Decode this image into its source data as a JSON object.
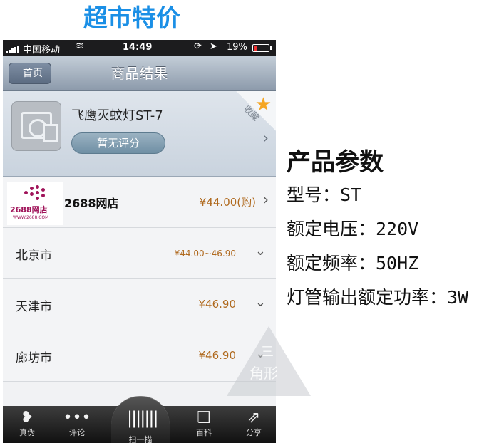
{
  "banner": {
    "title": "超市特价"
  },
  "status_bar": {
    "carrier": "中国移动",
    "time": "14:49",
    "battery": "19%"
  },
  "nav": {
    "back_label": "首页",
    "title": "商品结果"
  },
  "product": {
    "name": "飞鹰灭蚊灯ST-7",
    "rating": "暂无评分",
    "favorite_label": "收藏"
  },
  "shop": {
    "brand": "2688网店",
    "url": "WWW.2688.COM",
    "name": "2688网店",
    "price": "¥44.00(购)"
  },
  "cities": [
    {
      "name": "北京市",
      "price": "¥44.00~46.90"
    },
    {
      "name": "天津市",
      "price": "¥46.90"
    },
    {
      "name": "廊坊市",
      "price": "¥46.90"
    }
  ],
  "tabs": [
    {
      "label": "真伪",
      "icon": "heart-shield-icon"
    },
    {
      "label": "评论",
      "icon": "chat-bubble-icon"
    },
    {
      "label": "扫一描",
      "icon": "barcode-icon"
    },
    {
      "label": "百科",
      "icon": "book-icon"
    },
    {
      "label": "分享",
      "icon": "share-icon"
    }
  ],
  "specs": {
    "title": "产品参数",
    "lines": [
      "型号：ST",
      "额定电压：220V",
      "额定频率：50HZ",
      "灯管输出额定功率：3W"
    ]
  },
  "watermark": {
    "top": "三",
    "bottom": "角形"
  }
}
